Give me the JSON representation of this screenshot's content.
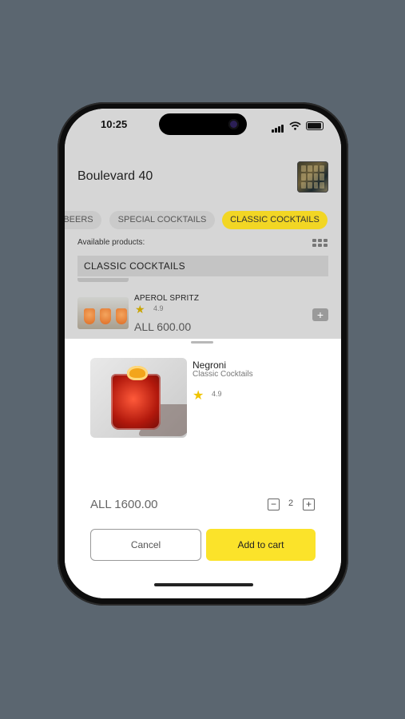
{
  "status_bar": {
    "time": "10:25"
  },
  "venue": {
    "title": "Boulevard 40"
  },
  "categories": [
    {
      "label": "BEERS",
      "active": false
    },
    {
      "label": "SPECIAL COCKTAILS",
      "active": false
    },
    {
      "label": "CLASSIC COCKTAILS",
      "active": true
    }
  ],
  "products_label": "Available products:",
  "section_title": "CLASSIC COCKTAILS",
  "product": {
    "name": "APEROL SPRITZ",
    "rating": "4.9",
    "price": "ALL 600.00"
  },
  "detail": {
    "name": "Negroni",
    "category": "Classic Cocktails",
    "rating": "4.9",
    "total": "ALL 1600.00",
    "quantity": "2",
    "cancel_label": "Cancel",
    "add_label": "Add to cart"
  },
  "colors": {
    "accent": "#fbe32a",
    "background": "#5b6670"
  },
  "icons": {
    "rating": "star-icon",
    "grid": "grid-view-icon",
    "add": "plus-icon",
    "minus": "minus-icon"
  }
}
